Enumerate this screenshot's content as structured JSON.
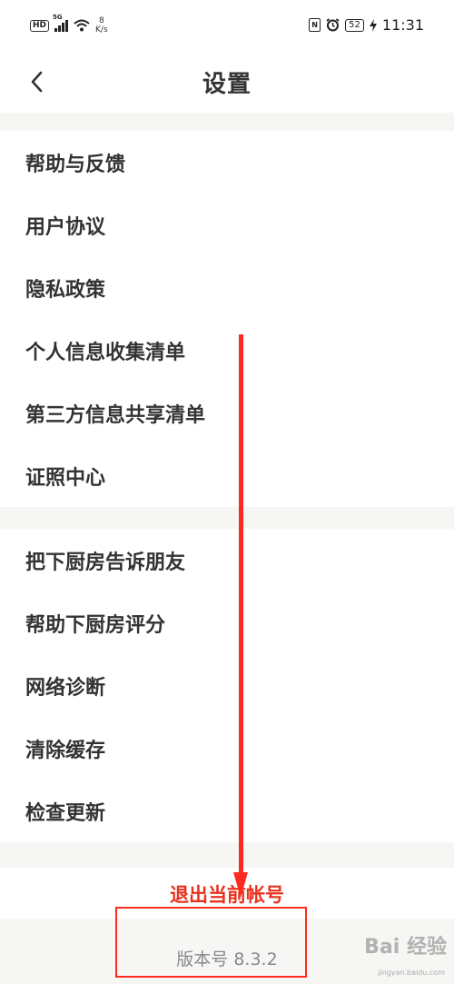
{
  "status_bar": {
    "hd": "HD",
    "network": "5G",
    "speed_value": "8",
    "speed_unit": "K/s",
    "nfc": "N",
    "battery": "52",
    "time": "11:31"
  },
  "header": {
    "title": "设置"
  },
  "sections": [
    {
      "items": [
        {
          "label": "帮助与反馈"
        },
        {
          "label": "用户协议"
        },
        {
          "label": "隐私政策"
        },
        {
          "label": "个人信息收集清单"
        },
        {
          "label": "第三方信息共享清单"
        },
        {
          "label": "证照中心"
        }
      ]
    },
    {
      "items": [
        {
          "label": "把下厨房告诉朋友"
        },
        {
          "label": "帮助下厨房评分"
        },
        {
          "label": "网络诊断"
        },
        {
          "label": "清除缓存"
        },
        {
          "label": "检查更新"
        }
      ]
    }
  ],
  "logout": {
    "label": "退出当前帐号"
  },
  "footer": {
    "version": "版本号 8.3.2"
  },
  "watermark": {
    "text": "Bai 经验",
    "url": "jingyan.baidu.com"
  },
  "colors": {
    "accent_red": "#e8321e",
    "annotation_red": "#ff2a1f",
    "background_gray": "#f6f6f4",
    "text": "#333333"
  }
}
